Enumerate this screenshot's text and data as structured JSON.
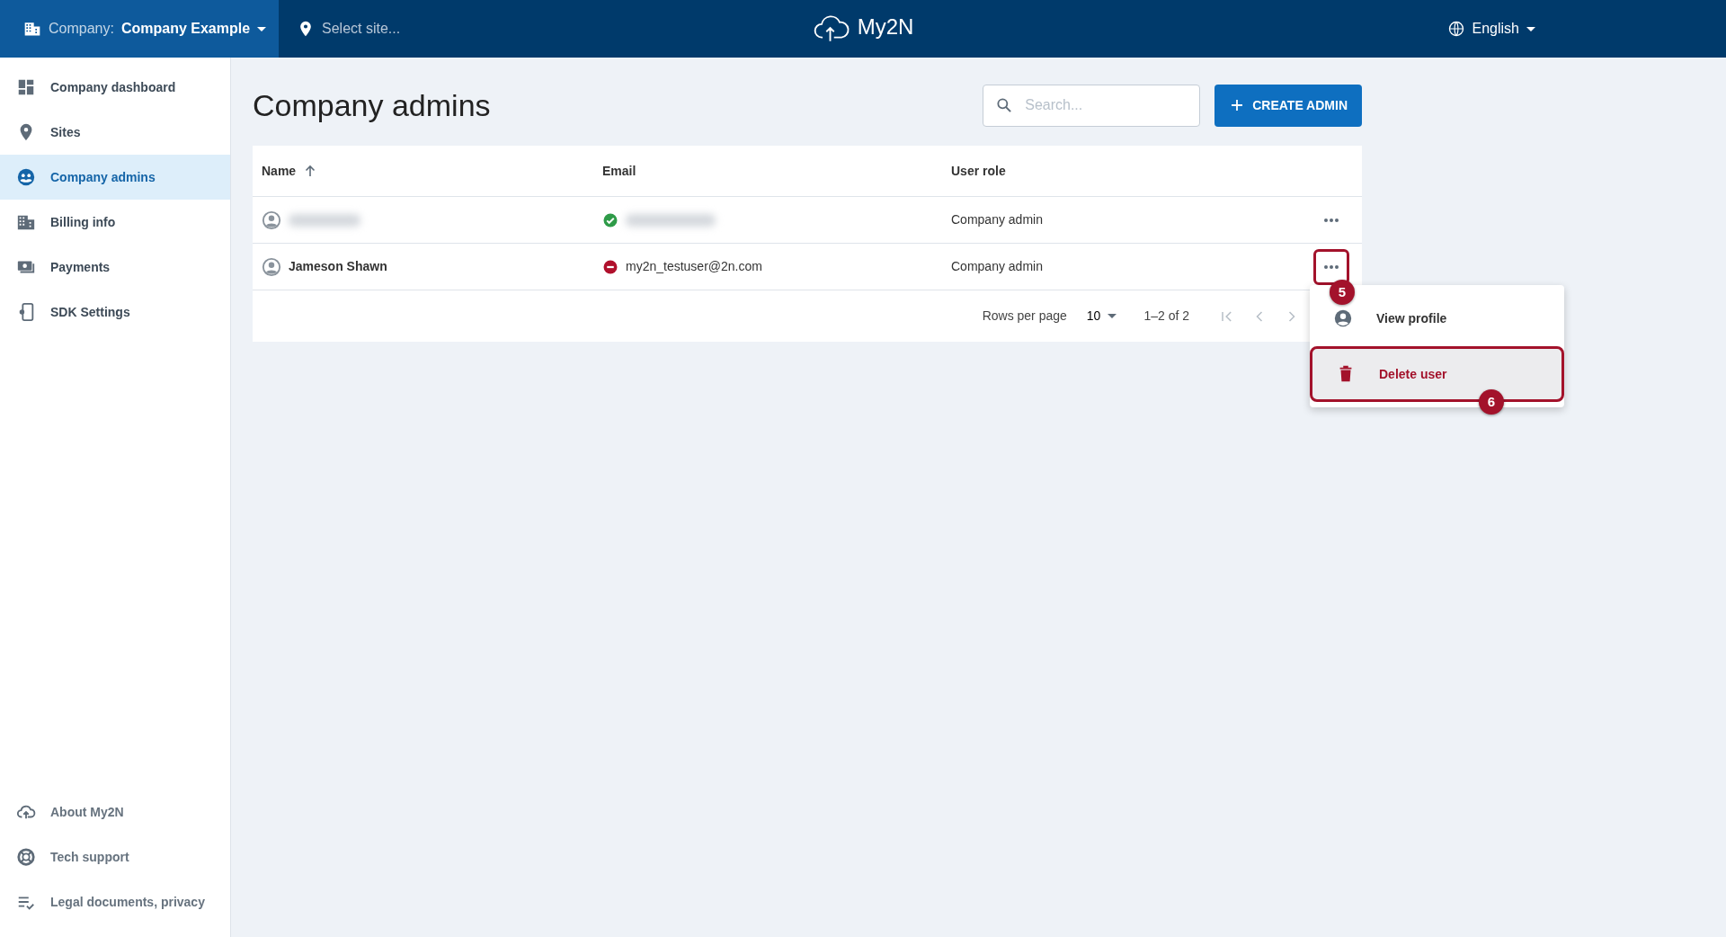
{
  "topbar": {
    "company_label": "Company:",
    "company_name": "Company Example",
    "site_placeholder": "Select site...",
    "logo_text": "My2N",
    "language": "English"
  },
  "sidebar": {
    "items": [
      {
        "label": "Company dashboard",
        "selected": false
      },
      {
        "label": "Sites",
        "selected": false
      },
      {
        "label": "Company admins",
        "selected": true
      },
      {
        "label": "Billing info",
        "selected": false
      },
      {
        "label": "Payments",
        "selected": false
      },
      {
        "label": "SDK Settings",
        "selected": false
      }
    ],
    "footer_items": [
      {
        "label": "About My2N"
      },
      {
        "label": "Tech support"
      },
      {
        "label": "Legal documents, privacy"
      }
    ]
  },
  "page": {
    "title": "Company admins",
    "search_placeholder": "Search...",
    "create_button": "CREATE ADMIN"
  },
  "table": {
    "columns": [
      {
        "label": "Name",
        "sorted": true
      },
      {
        "label": "Email",
        "sorted": false
      },
      {
        "label": "User role",
        "sorted": false
      }
    ],
    "rows": [
      {
        "redacted": true,
        "verified": true,
        "role": "Company admin",
        "menu_open": false
      },
      {
        "redacted": false,
        "name": "Jameson Shawn",
        "verified": false,
        "email": "my2n_testuser@2n.com",
        "role": "Company admin",
        "menu_open": true,
        "callout": "5"
      }
    ],
    "pagination": {
      "rows_per_page_label": "Rows per page",
      "rows_per_page": "10",
      "range": "1–2 of 2"
    }
  },
  "context_menu": {
    "items": [
      {
        "label": "View profile",
        "kind": "normal",
        "highlighted": false
      },
      {
        "label": "Delete user",
        "kind": "danger",
        "highlighted": true,
        "callout": "6"
      }
    ]
  }
}
